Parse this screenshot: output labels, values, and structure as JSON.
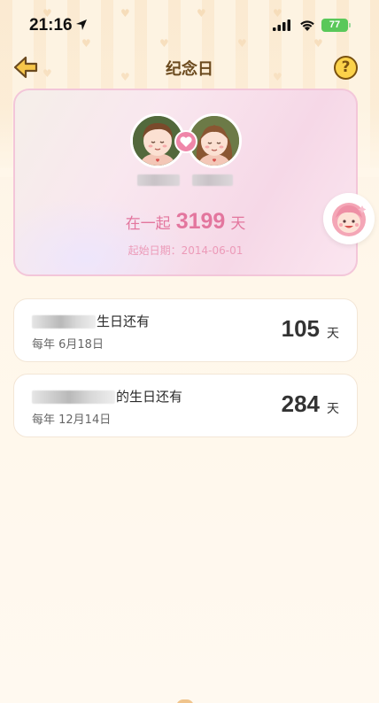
{
  "status_bar": {
    "time": "21:16",
    "battery": "77"
  },
  "nav": {
    "title": "纪念日",
    "help_label": "?"
  },
  "couple": {
    "together_prefix": "在一起",
    "days": "3199",
    "days_unit": "天",
    "start_date_text": "起始日期：2014-06-01"
  },
  "countdowns": [
    {
      "title_suffix": "生日还有",
      "date": "每年 6月18日",
      "days": "105",
      "unit": "天"
    },
    {
      "title_suffix": "的生日还有",
      "date": "每年 12月14日",
      "days": "284",
      "unit": "天"
    }
  ],
  "colors": {
    "accent_pink": "#e3769e",
    "battery_green": "#5ac85a",
    "help_yellow": "#fbd24a"
  }
}
